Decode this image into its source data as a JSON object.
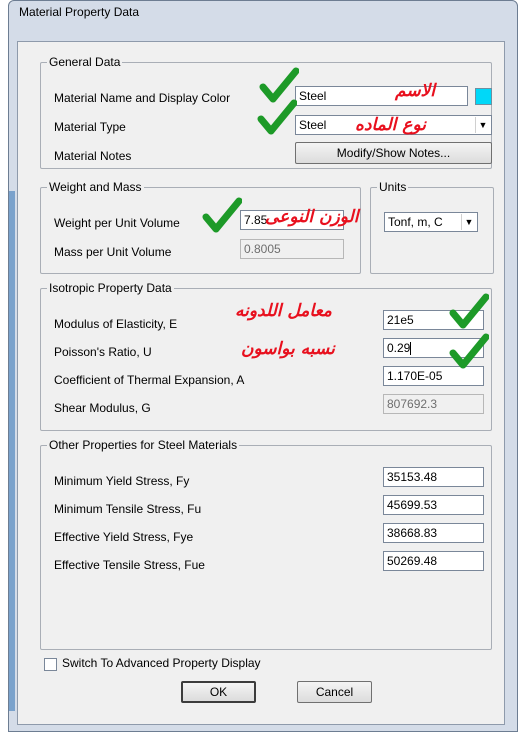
{
  "window": {
    "title": "Material Property Data"
  },
  "general": {
    "legend": "General Data",
    "name_label": "Material Name and Display Color",
    "name_value": "Steel",
    "display_color": "#00d8f8",
    "type_label": "Material Type",
    "type_value": "Steel",
    "notes_label": "Material Notes",
    "notes_button": "Modify/Show Notes..."
  },
  "weight": {
    "legend": "Weight and Mass",
    "weight_label": "Weight per Unit Volume",
    "weight_value": "7.85",
    "mass_label": "Mass per Unit Volume",
    "mass_value": "0.8005"
  },
  "units": {
    "legend": "Units",
    "value": "Tonf, m, C"
  },
  "isotropic": {
    "legend": "Isotropic Property Data",
    "e_label": "Modulus of Elasticity,  E",
    "e_value": "21e5",
    "u_label": "Poisson's Ratio,  U",
    "u_value": "0.29",
    "a_label": "Coefficient of Thermal Expansion,  A",
    "a_value": "1.170E-05",
    "g_label": "Shear Modulus,  G",
    "g_value": "807692.3"
  },
  "steel": {
    "legend": "Other Properties for Steel Materials",
    "fy_label": "Minimum Yield Stress, Fy",
    "fy_value": "35153.48",
    "fu_label": "Minimum Tensile Stress, Fu",
    "fu_value": "45699.53",
    "fye_label": "Effective Yield Stress, Fye",
    "fye_value": "38668.83",
    "fue_label": "Effective Tensile Stress, Fue",
    "fue_value": "50269.48"
  },
  "advanced": {
    "label": "Switch To Advanced Property Display",
    "checked": false
  },
  "buttons": {
    "ok": "OK",
    "cancel": "Cancel"
  },
  "annotations": {
    "name": "الاسم",
    "type": "نوع الماده",
    "weight": "الوزن النوعى",
    "elasticity": "معامل اللدونه",
    "poisson": "نسبه بواسون",
    "tick_color": "#1d9a28",
    "text_color": "#e8101e"
  }
}
